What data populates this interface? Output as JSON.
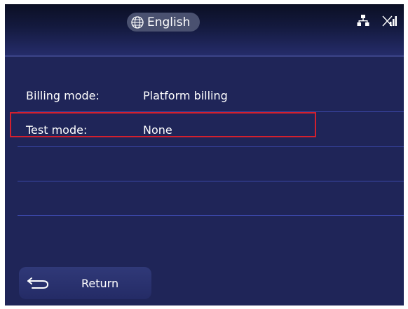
{
  "header": {
    "language_label": "English",
    "icons": [
      "globe-icon",
      "network-icon",
      "no-signal-icon"
    ]
  },
  "rows": [
    {
      "label": "Billing mode:",
      "value": "Platform billing"
    },
    {
      "label": "Test mode:",
      "value": "None"
    }
  ],
  "footer": {
    "return_label": "Return"
  },
  "colors": {
    "background": "#1f2558",
    "highlight_border": "#d3202e",
    "divider": "#3b47a8",
    "text": "#ffffff"
  }
}
